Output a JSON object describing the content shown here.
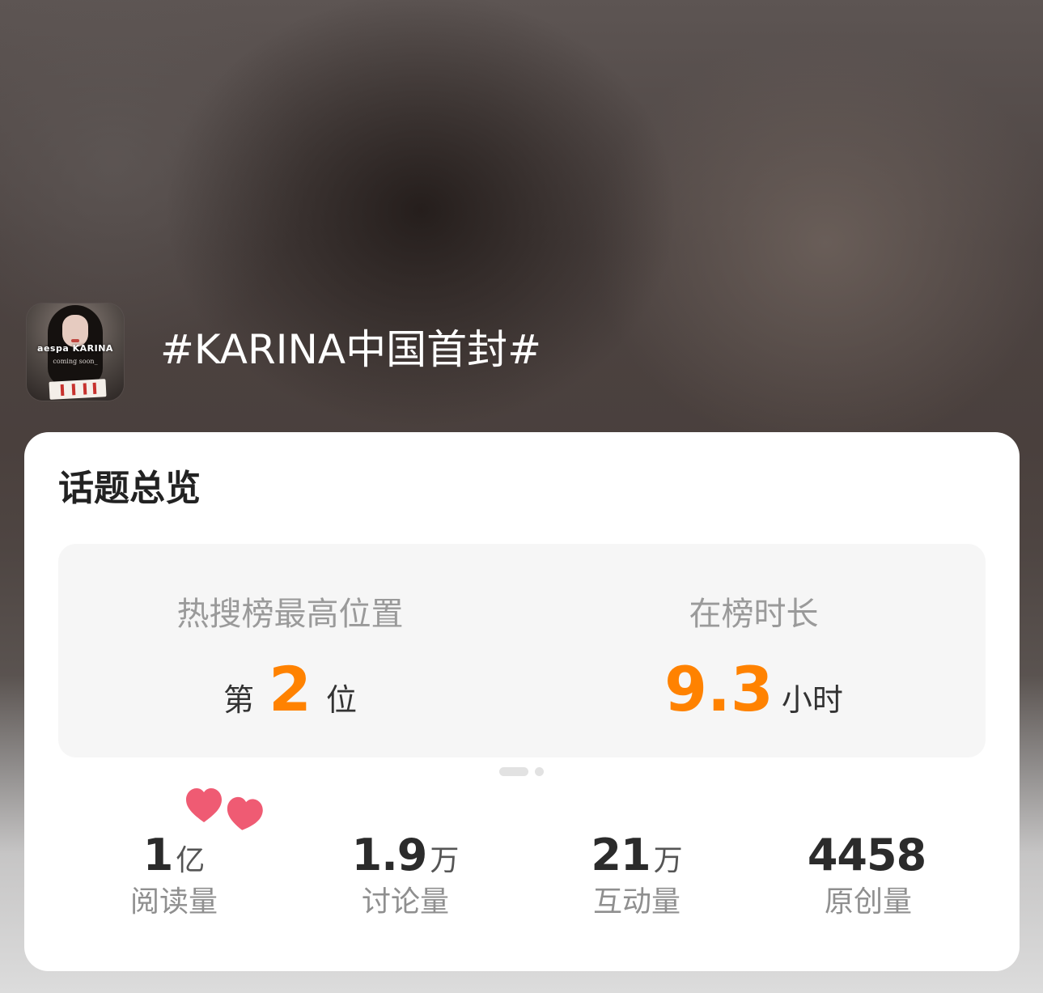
{
  "topic": {
    "title": "#KARINA中国首封#",
    "avatar": {
      "brand_text": "aespa KARINA",
      "sub_text": "coming soon_"
    }
  },
  "overview": {
    "title": "话题总览",
    "hot_search": {
      "label": "热搜榜最高位置",
      "prefix": "第",
      "value": "2",
      "suffix": "位"
    },
    "on_list_duration": {
      "label": "在榜时长",
      "value": "9.3",
      "unit": "小时"
    },
    "pager": {
      "pages": 2,
      "active_page": 1
    },
    "stats": [
      {
        "value": "1",
        "unit": "亿",
        "label": "阅读量"
      },
      {
        "value": "1.9",
        "unit": "万",
        "label": "讨论量"
      },
      {
        "value": "21",
        "unit": "万",
        "label": "互动量"
      },
      {
        "value": "4458",
        "unit": "",
        "label": "原创量"
      }
    ]
  },
  "colors": {
    "accent": "#ff8200",
    "heart": "#ef5b73",
    "card_bg": "#ffffff",
    "panel_bg": "#f6f6f6"
  },
  "icons": {
    "hearts_sticker": "hearts-icon"
  }
}
